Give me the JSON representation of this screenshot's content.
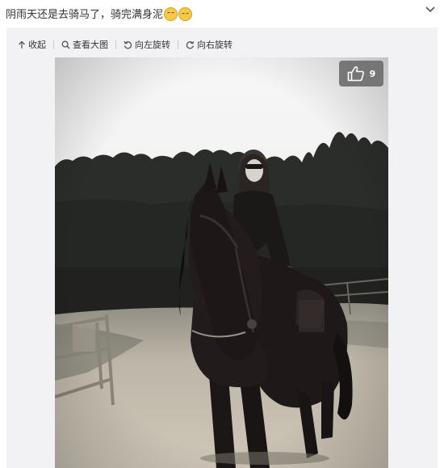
{
  "post": {
    "text_part1": "阴雨天还是去骑马了，骑完满身泥",
    "emojis": [
      "sad-face-emoji",
      "cat-face-emoji"
    ]
  },
  "header": {
    "menu_icon": "chevron-down-icon"
  },
  "toolbar": {
    "collapse_label": "收起",
    "view_large_label": "查看大图",
    "rotate_left_label": "向左旋转",
    "rotate_right_label": "向右旋转"
  },
  "photo": {
    "like_count": "9",
    "colors": {
      "sky": "#f0f0f0",
      "trees": "#2a2c29",
      "ground": "#c8c0b2",
      "horse": "#1c1616"
    }
  }
}
